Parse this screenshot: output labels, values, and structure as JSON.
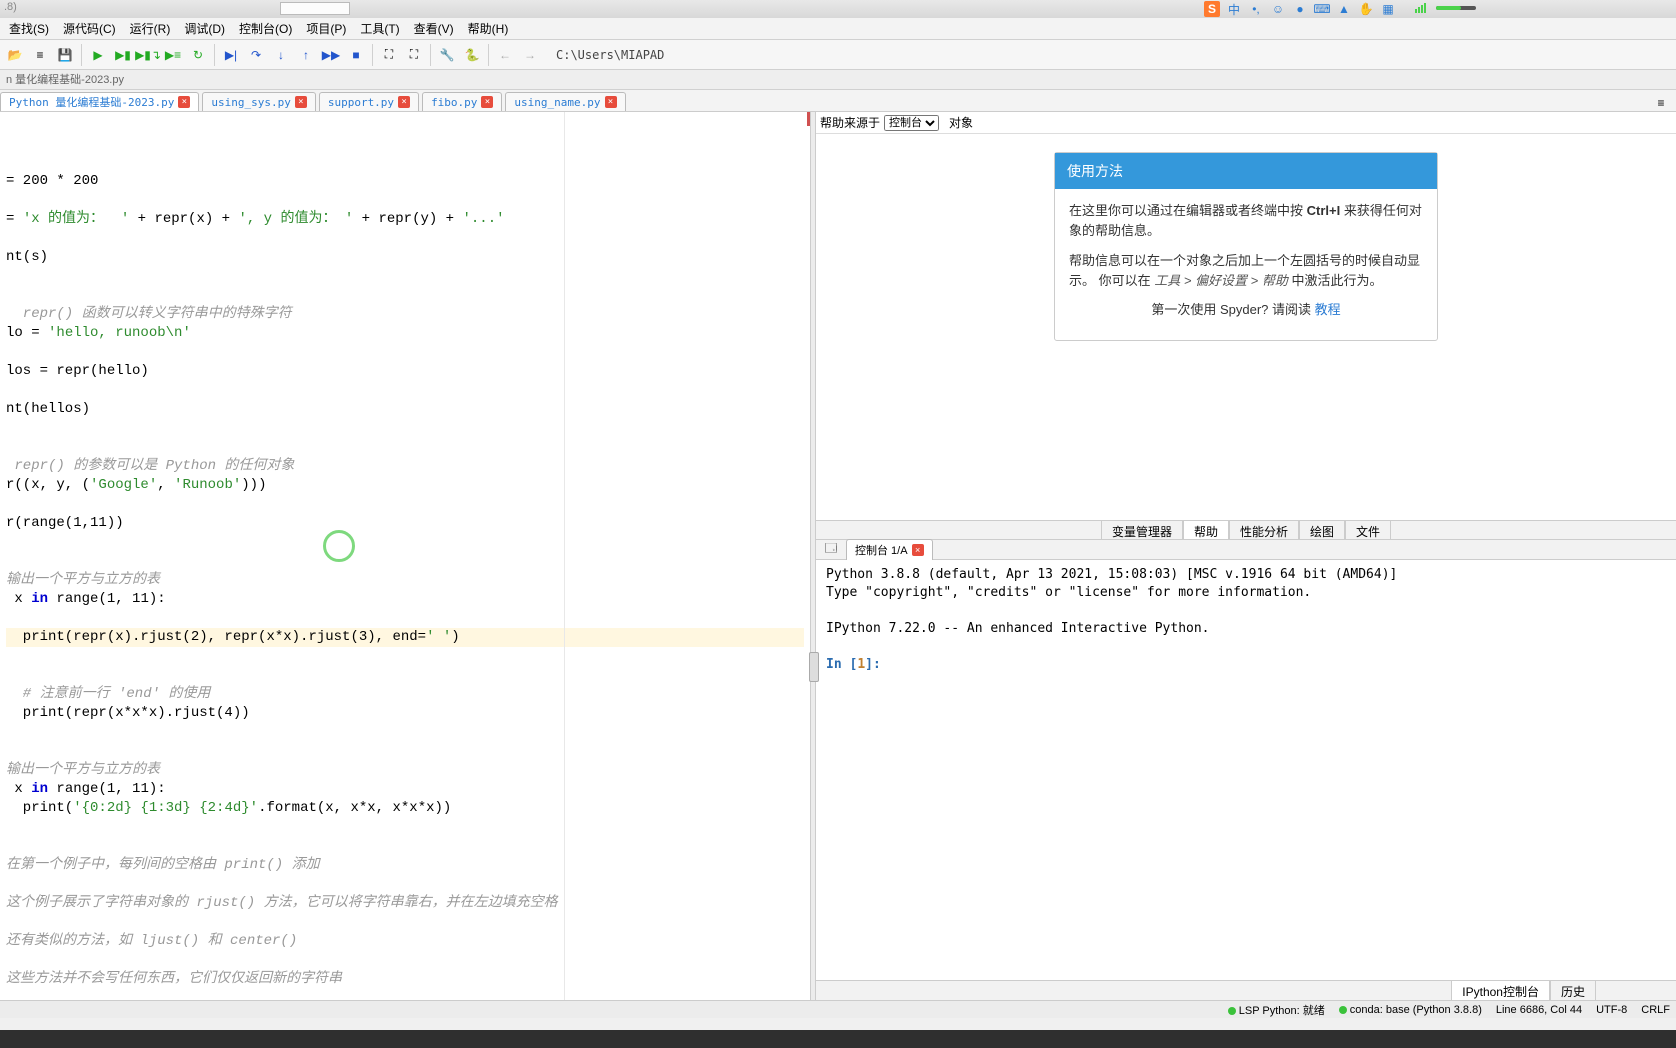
{
  "titlebar": {
    "left": ".8)"
  },
  "menu": {
    "find": "查找(S)",
    "source": "源代码(C)",
    "run": "运行(R)",
    "debug": "调试(D)",
    "console": "控制台(O)",
    "projects": "项目(P)",
    "tools": "工具(T)",
    "view": "查看(V)",
    "help": "帮助(H)"
  },
  "toolbar": {
    "path": "C:\\Users\\MIAPAD"
  },
  "breadcrumb": "n 量化编程基础-2023.py",
  "tabs": [
    {
      "label": "Python 量化编程基础-2023.py",
      "active": true
    },
    {
      "label": "using_sys.py"
    },
    {
      "label": "support.py"
    },
    {
      "label": "fibo.py"
    },
    {
      "label": "using_name.py"
    }
  ],
  "code": {
    "l1": "= 200 * 200",
    "l2a": "= ",
    "l2b": "'x 的值为：  '",
    "l2c": " + repr(x) + ",
    "l2d": "', y 的值为： '",
    "l2e": " + repr(y) + ",
    "l2f": "'...'",
    "l3": "nt(s)",
    "l4": "  repr() 函数可以转义字符串中的特殊字符",
    "l5a": "lo = ",
    "l5b": "'hello, runoob\\n'",
    "l6": "los = repr(hello)",
    "l7": "nt(hellos)",
    "l8": " repr() 的参数可以是 Python 的任何对象",
    "l9a": "r((x, y, (",
    "l9b": "'Google'",
    "l9c": ", ",
    "l9d": "'Runoob'",
    "l9e": ")))",
    "l10": "r(range(1,11))",
    "l11": "输出一个平方与立方的表",
    "l12a": " x ",
    "l12b": "in",
    "l12c": " range(1, 11):",
    "l13a": "  print(repr(x).rjust(2), repr(x*x).rjust(3), end=",
    "l13b": "' '",
    "l13c": ")",
    "l14": "  # 注意前一行 'end' 的使用",
    "l15": "  print(repr(x*x*x).rjust(4))",
    "l16": "输出一个平方与立方的表",
    "l17a": " x ",
    "l17b": "in",
    "l17c": " range(1, 11):",
    "l18a": "  print(",
    "l18b": "'{0:2d} {1:3d} {2:4d}'",
    "l18c": ".format(x, x*x, x*x*x))",
    "l19": "在第一个例子中，每列间的空格由 print() 添加",
    "l20": "这个例子展示了字符串对象的 rjust() 方法，它可以将字符串靠右，并在左边填充空格",
    "l21": "还有类似的方法，如 ljust() 和 center()",
    "l22": "这些方法并不会写任何东西，它们仅仅返回新的字符串"
  },
  "help": {
    "src_label": "帮助来源于",
    "obj_label": "对象",
    "select_option": "控制台",
    "card_head": "使用方法",
    "p1a": "在这里你可以通过在编辑器或者终端中按 ",
    "p1b": "Ctrl+I",
    "p1c": " 来获得任何对象的帮助信息。",
    "p2a": "帮助信息可以在一个对象之后加上一个左圆括号的时候自动显示。 你可以在 ",
    "p2b": "工具 > 偏好设置 > 帮助",
    "p2c": " 中激活此行为。",
    "foot_a": "第一次使用 Spyder? 请阅读 ",
    "foot_link": "教程"
  },
  "panel_tabs": {
    "var": "变量管理器",
    "help": "帮助",
    "perf": "性能分析",
    "plot": "绘图",
    "file": "文件"
  },
  "console": {
    "tab_label": "控制台 1/A",
    "line1": "Python 3.8.8 (default, Apr 13 2021, 15:08:03) [MSC v.1916 64 bit (AMD64)]",
    "line2": "Type \"copyright\", \"credits\" or \"license\" for more information.",
    "line3": "IPython 7.22.0 -- An enhanced Interactive Python.",
    "prompt_in": "In [",
    "prompt_n": "1",
    "prompt_close": "]:"
  },
  "bottom_tabs": {
    "ipy": "IPython控制台",
    "hist": "历史"
  },
  "status": {
    "lsp": "LSP Python: 就绪",
    "conda": "conda: base (Python 3.8.8)",
    "pos": "Line 6686, Col 44",
    "enc": "UTF-8",
    "eol": "CRLF"
  }
}
